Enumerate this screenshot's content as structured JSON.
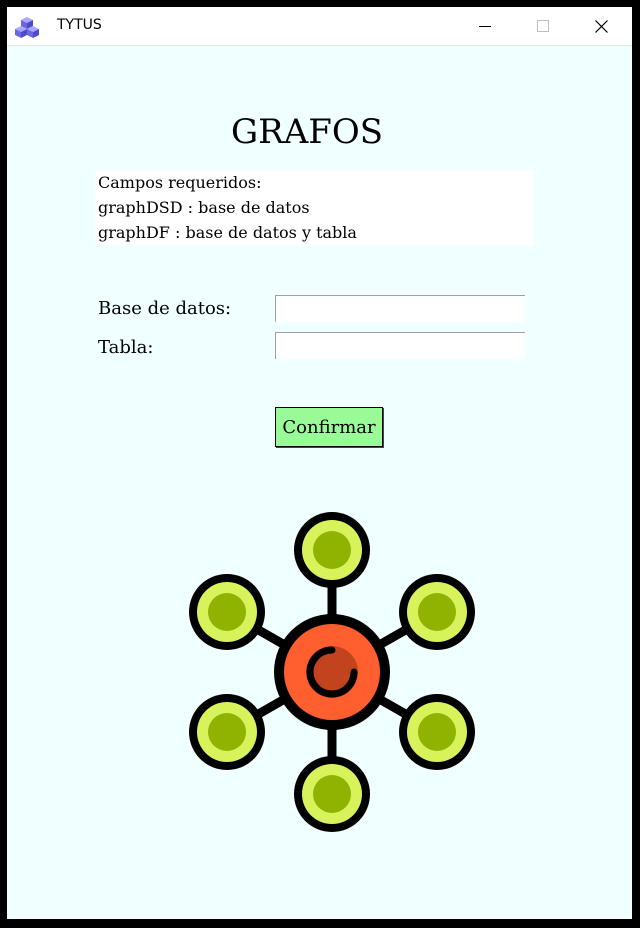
{
  "window": {
    "title": "TYTUS",
    "app_icon": "cubes-icon",
    "controls": {
      "minimize": "minimize-icon",
      "maximize": "maximize-icon",
      "close": "close-icon"
    }
  },
  "page": {
    "title": "GRAFOS",
    "info_lines": [
      "Campos requeridos:",
      "graphDSD : base de datos",
      "graphDF : base de datos y tabla"
    ]
  },
  "form": {
    "database_label": "Base de datos:",
    "database_value": "",
    "table_label": "Tabla:",
    "table_value": "",
    "confirm_label": "Confirmar"
  },
  "illustration": {
    "icon": "network-graph-icon",
    "colors": {
      "center": "#ff5f2e",
      "center_inner": "#c1441e",
      "node_outer": "#d7f25a",
      "node_inner": "#8fb300",
      "outline": "#000000"
    }
  },
  "colors": {
    "window_background": "#f0ffff",
    "button_background": "#98fb98"
  }
}
